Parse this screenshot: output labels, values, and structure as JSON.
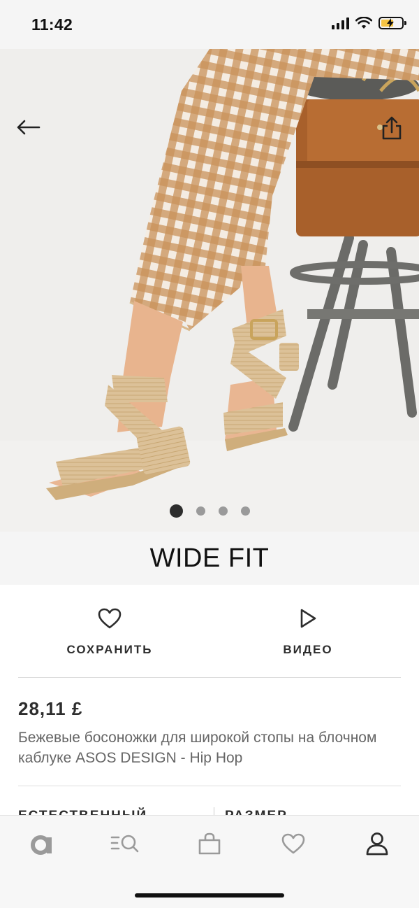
{
  "status_bar": {
    "time": "11:42",
    "icons": [
      "signal-icon",
      "wifi-icon",
      "battery-charging-icon"
    ],
    "battery_color": "#f6c443"
  },
  "hero": {
    "image": "product-photo",
    "back_icon": "arrow-left-icon",
    "share_icon": "share-icon",
    "carousel": {
      "count": 4,
      "active_index": 0
    }
  },
  "fit_banner": {
    "text": "WIDE FIT"
  },
  "actions": {
    "save_label": "СОХРАНИТЬ",
    "save_icon": "heart-icon",
    "video_label": "ВИДЕО",
    "video_icon": "play-icon"
  },
  "product": {
    "price": "28,11 £",
    "title": "Бежевые босоножки для широкой стопы на блочном каблуке ASOS DESIGN - Hip Hop"
  },
  "selectors": {
    "colour_label": "ЕСТЕСТВЕННЫЙ",
    "size_label": "РАЗМЕР"
  },
  "bottom_nav": {
    "items": [
      {
        "icon": "asos-logo-icon",
        "active": false
      },
      {
        "icon": "search-menu-icon",
        "active": false
      },
      {
        "icon": "bag-icon",
        "active": false
      },
      {
        "icon": "heart-icon",
        "active": false
      },
      {
        "icon": "account-icon",
        "active": true
      }
    ]
  },
  "colors": {
    "text_primary": "#2d2d2d",
    "text_secondary": "#666666",
    "inactive_icon": "#9a9a9a"
  }
}
